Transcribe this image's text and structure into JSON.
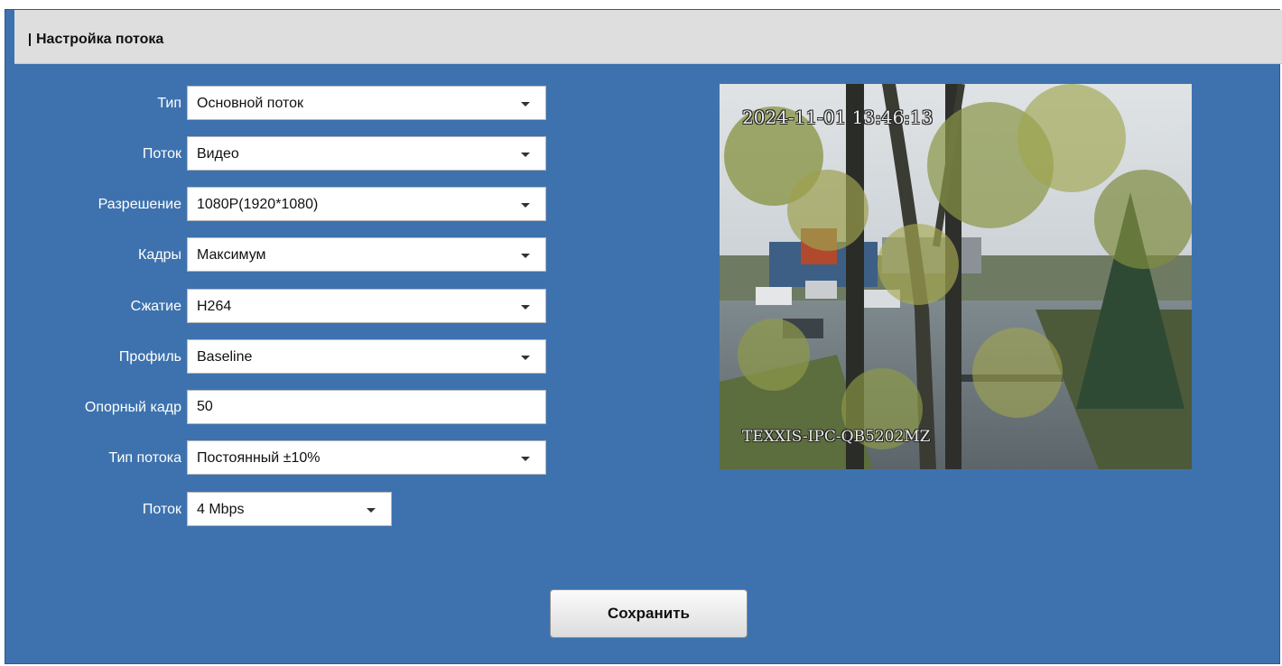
{
  "panel": {
    "title": "Настройка потока"
  },
  "form": {
    "type": {
      "label": "Тип",
      "value": "Основной поток"
    },
    "stream": {
      "label": "Поток",
      "value": "Видео"
    },
    "resolution": {
      "label": "Разрешение",
      "value": "1080P(1920*1080)"
    },
    "frames": {
      "label": "Кадры",
      "value": "Максимум"
    },
    "compression": {
      "label": "Сжатие",
      "value": "H264"
    },
    "profile": {
      "label": "Профиль",
      "value": "Baseline"
    },
    "keyframe": {
      "label": "Опорный кадр",
      "value": "50"
    },
    "stream_type": {
      "label": "Тип потока",
      "value": "Постоянный ±10%"
    },
    "bitrate": {
      "label": "Поток",
      "value": "4 Mbps"
    }
  },
  "preview": {
    "timestamp": "2024-11-01 13:46:13",
    "camera_name": "TEXXIS-IPC-QB5202MZ"
  },
  "actions": {
    "save_label": "Сохранить"
  },
  "colors": {
    "panel_bg": "#3e72ae",
    "header_bg": "#dedede"
  }
}
